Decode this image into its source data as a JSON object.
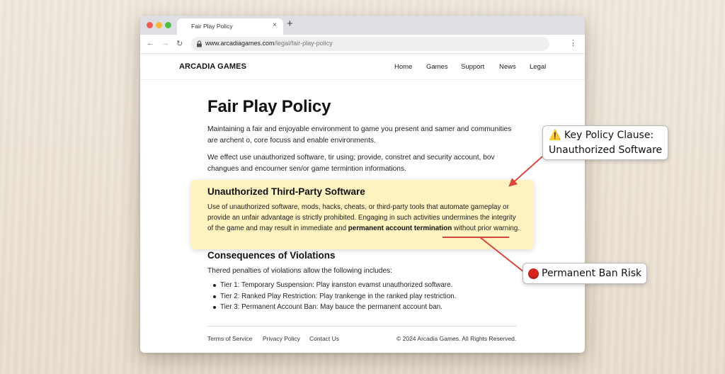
{
  "browser": {
    "tab_title": "Fair Play Policy",
    "tab_close": "×",
    "new_tab": "+",
    "url_domain": "www.arcadiagames.com",
    "url_path": "/legal/fair-play-policy",
    "back": "←",
    "forward": "→",
    "reload": "↻",
    "menu": "⋮",
    "window_controls": {
      "close_color": "#ee5b53",
      "minimize_color": "#f3b83b",
      "maximize_color": "#4cbf44"
    }
  },
  "site": {
    "logo": "ARCADIA GAMES",
    "nav": [
      "Home",
      "Games",
      "Support",
      "News",
      "Legal"
    ]
  },
  "page": {
    "title": "Fair Play Policy",
    "intro_1": "Maintaining a fair and enjoyable environment to game you present and samer and communities are archent o, core focuss and enable environments.",
    "intro_2": "We effect use unauthorized software, tir using; provide, constret and security account, bov changues and encourner sen/or game termintion informations.",
    "highlight": {
      "title": "Unauthorized Third-Party Software",
      "body_before": "Use of unauthorized software, mods, hacks, cheats, or third-party tools that automate gameplay or provide an unfair advantage is strictly prohibited. Engaging in such activities undermines the integrity of the game and may result in immediate and ",
      "body_bold": "permanent account termination",
      "body_after": " without prior warning.",
      "background_color": "#fdf2c0"
    },
    "consequences_title": "Consequences of Violations",
    "consequences_intro": "Thered penalties of violations allow the following includes:",
    "tiers": [
      "Tier 1: Temporary Suspension: Play iranston evamst unauthorized software.",
      "Tier 2: Ranked Play Restriction: Play trankenge in the ranked play restriction.",
      "Tier 3: Permanent Account Ban: May bauce the permanent account ban."
    ]
  },
  "footer": {
    "links": [
      "Terms of Service",
      "Privacy Policy",
      "Contact Us"
    ],
    "copyright": "© 2024 Arcadia Games. All Rights Reserved."
  },
  "annotations": {
    "callout_1": {
      "icon": "⚠️",
      "line_1": "Key Policy Clause:",
      "line_2": "Unauthorized Software"
    },
    "callout_2": {
      "icon": "red-circle-icon",
      "text": "Permanent Ban Risk"
    },
    "arrow_color": "#d9473d"
  }
}
